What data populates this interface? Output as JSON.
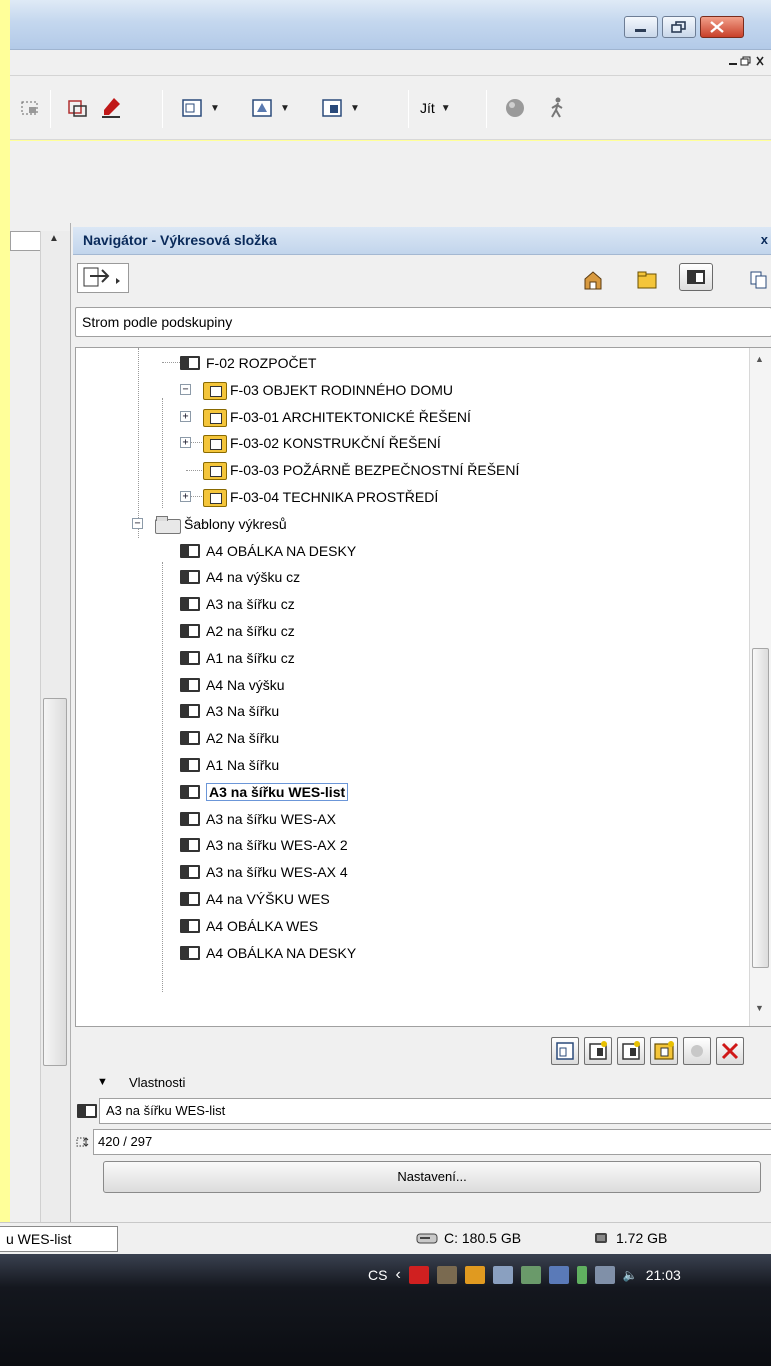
{
  "toolbar": {
    "jit_label": "Jít"
  },
  "navigator": {
    "title": "Navigátor - Výkresová složka",
    "close_glyph": "x",
    "mode_select": "Strom podle podskupiny",
    "tree": [
      {
        "label": "F-02 ROZPOČET",
        "icon": "layout-icon",
        "expand": ""
      },
      {
        "label": "F-03 OBJEKT RODINNÉHO  DOMU",
        "icon": "subset-icon",
        "expand": "−"
      },
      {
        "label": "F-03-01 ARCHITEKTONICKÉ ŘEŠENÍ",
        "icon": "subset-icon",
        "expand": "+"
      },
      {
        "label": "F-03-02 KONSTRUKČNÍ ŘEŠENÍ",
        "icon": "subset-icon",
        "expand": "+"
      },
      {
        "label": "F-03-03 POŽÁRNĚ BEZPEČNOSTNÍ ŘEŠENÍ",
        "icon": "subset-icon",
        "expand": ""
      },
      {
        "label": "F-03-04 TECHNIKA PROSTŘEDÍ",
        "icon": "subset-icon",
        "expand": "+"
      },
      {
        "label": "Šablony výkresů",
        "icon": "folder-icon",
        "expand": "−"
      },
      {
        "label": "A4  OBÁLKA NA DESKY",
        "icon": "layout-icon",
        "expand": ""
      },
      {
        "label": "A4 na výšku cz",
        "icon": "layout-icon",
        "expand": ""
      },
      {
        "label": "A3 na šířku cz",
        "icon": "layout-icon",
        "expand": ""
      },
      {
        "label": "A2 na šířku cz",
        "icon": "layout-icon",
        "expand": ""
      },
      {
        "label": "A1 na šířku cz",
        "icon": "layout-icon",
        "expand": ""
      },
      {
        "label": "A4 Na výšku",
        "icon": "layout-icon",
        "expand": ""
      },
      {
        "label": "A3 Na šířku",
        "icon": "layout-icon",
        "expand": ""
      },
      {
        "label": "A2 Na šířku",
        "icon": "layout-icon",
        "expand": ""
      },
      {
        "label": "A1 Na šířku",
        "icon": "layout-icon",
        "expand": ""
      },
      {
        "label": "A3 na šířku WES-list",
        "icon": "layout-icon",
        "expand": "",
        "selected": true
      },
      {
        "label": "A3 na šířku WES-AX",
        "icon": "layout-icon",
        "expand": ""
      },
      {
        "label": "A3 na šířku WES-AX 2",
        "icon": "layout-icon",
        "expand": ""
      },
      {
        "label": "A3 na šířku WES-AX 4",
        "icon": "layout-icon",
        "expand": ""
      },
      {
        "label": "A4 na VÝŠKU WES",
        "icon": "layout-icon",
        "expand": ""
      },
      {
        "label": "A4  OBÁLKA WES",
        "icon": "layout-icon",
        "expand": ""
      },
      {
        "label": "A4  OBÁLKA NA DESKY",
        "icon": "layout-icon",
        "expand": ""
      }
    ]
  },
  "properties": {
    "header": "Vlastnosti",
    "name": "A3 na šířku WES-list",
    "size": "420 / 297",
    "settings_button": "Nastavení..."
  },
  "status": {
    "document": "u WES-list",
    "disk": "C: 180.5 GB",
    "memory": "1.72 GB"
  },
  "taskbar": {
    "language": "CS",
    "clock": "21:03"
  }
}
